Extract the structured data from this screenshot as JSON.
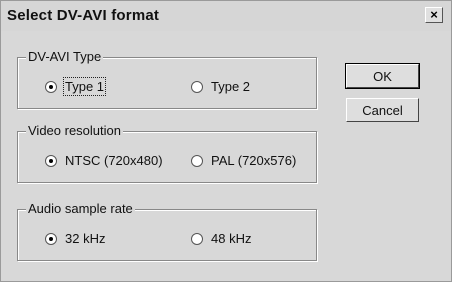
{
  "window": {
    "title": "Select DV-AVI format",
    "close_label": "×"
  },
  "groups": {
    "type": {
      "label": "DV-AVI Type",
      "options": [
        "Type 1",
        "Type 2"
      ],
      "selected": "Type 1"
    },
    "resolution": {
      "label": "Video resolution",
      "options": [
        "NTSC (720x480)",
        "PAL (720x576)"
      ],
      "selected": "NTSC (720x480)"
    },
    "audio": {
      "label": "Audio sample rate",
      "options": [
        "32 kHz",
        "48 kHz"
      ],
      "selected": "32 kHz"
    }
  },
  "buttons": {
    "ok": "OK",
    "cancel": "Cancel"
  }
}
